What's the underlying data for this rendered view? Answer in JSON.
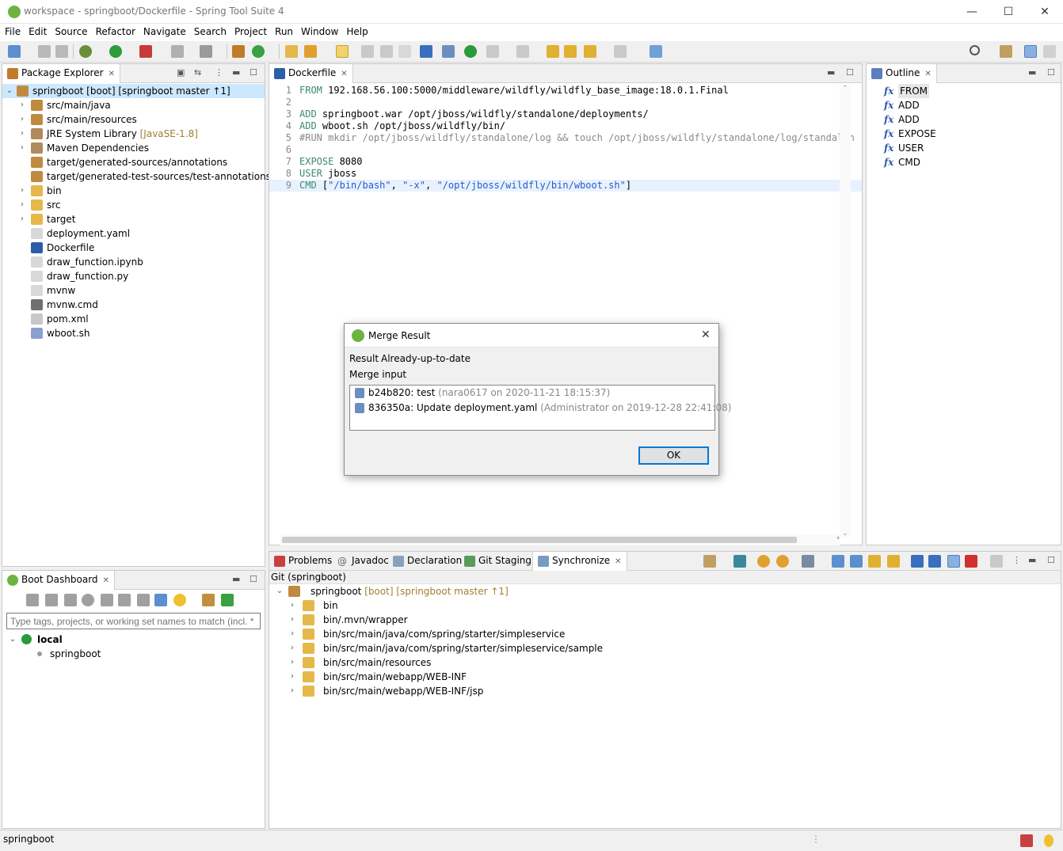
{
  "window": {
    "title": "workspace - springboot/Dockerfile - Spring Tool Suite 4",
    "minimize": "—",
    "maximize": "☐",
    "close": "✕"
  },
  "menu": [
    "File",
    "Edit",
    "Source",
    "Refactor",
    "Navigate",
    "Search",
    "Project",
    "Run",
    "Window",
    "Help"
  ],
  "package_explorer": {
    "tab": "Package Explorer",
    "root": {
      "label": "springboot [boot] [springboot master ↑1]"
    },
    "items": [
      {
        "label": "src/main/java",
        "deco": "",
        "expandable": true,
        "icon": "source-folder-icon"
      },
      {
        "label": "src/main/resources",
        "deco": "",
        "expandable": true,
        "icon": "source-folder-icon"
      },
      {
        "label": "JRE System Library",
        "deco": "[JavaSE-1.8]",
        "expandable": true,
        "icon": "library-icon"
      },
      {
        "label": "Maven Dependencies",
        "deco": "",
        "expandable": true,
        "icon": "library-icon"
      },
      {
        "label": "target/generated-sources/annotations",
        "deco": "",
        "expandable": false,
        "icon": "source-folder-icon"
      },
      {
        "label": "target/generated-test-sources/test-annotations",
        "deco": "",
        "expandable": false,
        "icon": "source-folder-icon"
      },
      {
        "label": "bin",
        "deco": "",
        "expandable": true,
        "icon": "folder-icon"
      },
      {
        "label": "src",
        "deco": "",
        "expandable": true,
        "icon": "folder-icon"
      },
      {
        "label": "target",
        "deco": "",
        "expandable": true,
        "icon": "folder-icon"
      },
      {
        "label": "deployment.yaml",
        "deco": "",
        "expandable": false,
        "icon": "file-icon"
      },
      {
        "label": "Dockerfile",
        "deco": "",
        "expandable": false,
        "icon": "docker-file-icon"
      },
      {
        "label": "draw_function.ipynb",
        "deco": "",
        "expandable": false,
        "icon": "file-icon"
      },
      {
        "label": "draw_function.py",
        "deco": "",
        "expandable": false,
        "icon": "file-icon"
      },
      {
        "label": "mvnw",
        "deco": "",
        "expandable": false,
        "icon": "file-icon"
      },
      {
        "label": "mvnw.cmd",
        "deco": "",
        "expandable": false,
        "icon": "cmd-file-icon"
      },
      {
        "label": "pom.xml",
        "deco": "",
        "expandable": false,
        "icon": "xml-file-icon"
      },
      {
        "label": "wboot.sh",
        "deco": "",
        "expandable": false,
        "icon": "shell-file-icon"
      }
    ]
  },
  "editor": {
    "tab": "Dockerfile",
    "lines": [
      {
        "n": "1",
        "kw": "FROM",
        "rest": " 192.168.56.100:5000/middleware/wildfly/wildfly_base_image:18.0.1.Final"
      },
      {
        "n": "2",
        "kw": "",
        "rest": ""
      },
      {
        "n": "3",
        "kw": "ADD",
        "rest": " springboot.war /opt/jboss/wildfly/standalone/deployments/"
      },
      {
        "n": "4",
        "kw": "ADD",
        "rest": " wboot.sh /opt/jboss/wildfly/bin/"
      },
      {
        "n": "5",
        "kw": "",
        "comment": "#RUN mkdir /opt/jboss/wildfly/standalone/log && touch /opt/jboss/wildfly/standalone/log/standalon"
      },
      {
        "n": "6",
        "kw": "",
        "rest": ""
      },
      {
        "n": "7",
        "kw": "EXPOSE",
        "rest": " 8080"
      },
      {
        "n": "8",
        "kw": "USER",
        "rest": " jboss"
      },
      {
        "n": "9",
        "kw": "CMD",
        "rest": " [",
        "s1": "\"/bin/bash\"",
        "c1": ", ",
        "s2": "\"-x\"",
        "c2": ", ",
        "s3": "\"/opt/jboss/wildfly/bin/wboot.sh\"",
        "end": "]"
      }
    ]
  },
  "outline": {
    "tab": "Outline",
    "items": [
      "FROM",
      "ADD",
      "ADD",
      "EXPOSE",
      "USER",
      "CMD"
    ],
    "fx": "fx"
  },
  "boot_dashboard": {
    "tab": "Boot Dashboard",
    "filter_placeholder": "Type tags, projects, or working set names to match (incl. * and ? wildcards)",
    "group": "local",
    "app": "springboot"
  },
  "bottom": {
    "tabs": [
      "Problems",
      "Javadoc",
      "Declaration",
      "Git Staging",
      "Synchronize"
    ],
    "sync_title": "Git (springboot)",
    "root_label": "springboot",
    "root_deco": "[boot] [springboot master ↑1]",
    "items": [
      "bin",
      "bin/.mvn/wrapper",
      "bin/src/main/java/com/spring/starter/simpleservice",
      "bin/src/main/java/com/spring/starter/simpleservice/sample",
      "bin/src/main/resources",
      "bin/src/main/webapp/WEB-INF",
      "bin/src/main/webapp/WEB-INF/jsp"
    ]
  },
  "dialog": {
    "title": "Merge Result",
    "result_label": "Result",
    "result_value": "Already-up-to-date",
    "merge_input_label": "Merge input",
    "commits": [
      {
        "id": "b24b820: test",
        "meta": "(nara0617 on 2020-11-21 18:15:37)"
      },
      {
        "id": "836350a: Update deployment.yaml",
        "meta": "(Administrator on 2019-12-28 22:41:08)"
      }
    ],
    "ok": "OK"
  },
  "statusbar": {
    "text": "springboot"
  },
  "colors": {
    "spring_green": "#6db33f",
    "selection": "#cce8ff",
    "focus_blue": "#0078d7"
  }
}
